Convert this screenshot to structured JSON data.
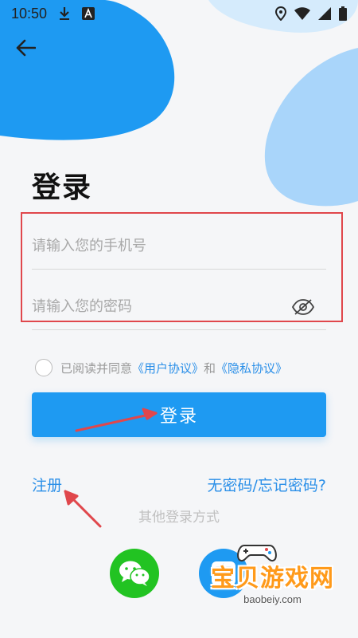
{
  "status_bar": {
    "time": "10:50",
    "icons": [
      "download-icon",
      "app-a-icon",
      "location-icon",
      "wifi-icon",
      "signal-icon",
      "battery-icon"
    ]
  },
  "nav": {
    "back_icon": "arrow-left-icon"
  },
  "page": {
    "title": "登录"
  },
  "form": {
    "phone_value": "",
    "phone_placeholder": "请输入您的手机号",
    "password_value": "",
    "password_placeholder": "请输入您的密码",
    "visibility_icon": "eye-off-icon"
  },
  "agreement": {
    "prefix": "已阅读并同意",
    "user_agreement": "《用户协议》",
    "and": "和",
    "privacy_agreement": "《隐私协议》",
    "checked": false
  },
  "actions": {
    "login_label": "登录",
    "register_label": "注册",
    "forgot_label": "无密码/忘记密码?"
  },
  "other_login": {
    "title": "其他登录方式",
    "options": [
      "wechat-icon",
      "alipay-icon"
    ]
  },
  "watermark": {
    "text": "宝贝游戏网",
    "url": "baobeiy.com"
  },
  "colors": {
    "accent": "#1e9af2",
    "link": "#2a8fe8",
    "highlight": "#e0474c",
    "wechat": "#22c322",
    "watermark": "#ff9a1a"
  }
}
